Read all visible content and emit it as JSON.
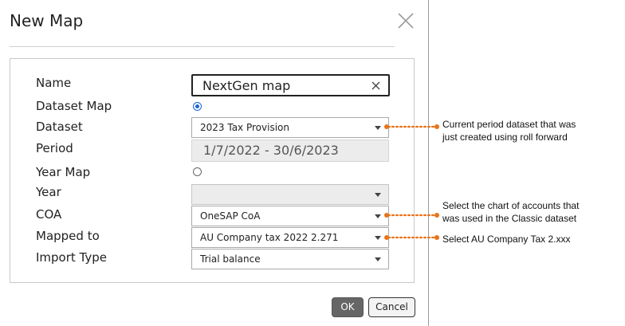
{
  "dialog": {
    "title": "New Map",
    "close_icon": "close-icon"
  },
  "form": {
    "labels": {
      "name": "Name",
      "dataset_map": "Dataset Map",
      "dataset": "Dataset",
      "period": "Period",
      "year_map": "Year Map",
      "year": "Year",
      "coa": "COA",
      "mapped_to": "Mapped to",
      "import_type": "Import Type"
    },
    "name_value": "NextGen map",
    "dataset_map_selected": true,
    "year_map_selected": false,
    "dataset_value": "2023 Tax Provision",
    "period_value": "1/7/2022 - 30/6/2023",
    "year_value": "",
    "coa_value": "OneSAP CoA",
    "mapped_to_value": "AU Company tax 2022 2.271",
    "import_type_value": "Trial balance"
  },
  "buttons": {
    "ok": "OK",
    "cancel": "Cancel"
  },
  "annotations": {
    "dataset_line1": "Current period dataset that was",
    "dataset_line2": "just created using roll forward",
    "coa_line1": "Select the chart of accounts that",
    "coa_line2": "was used in the Classic dataset",
    "mapped_line1": "Select AU Company Tax 2.xxx"
  },
  "colors": {
    "annotation_accent": "#e8731a",
    "radio_selected": "#1a66d6",
    "ok_button": "#666666"
  }
}
